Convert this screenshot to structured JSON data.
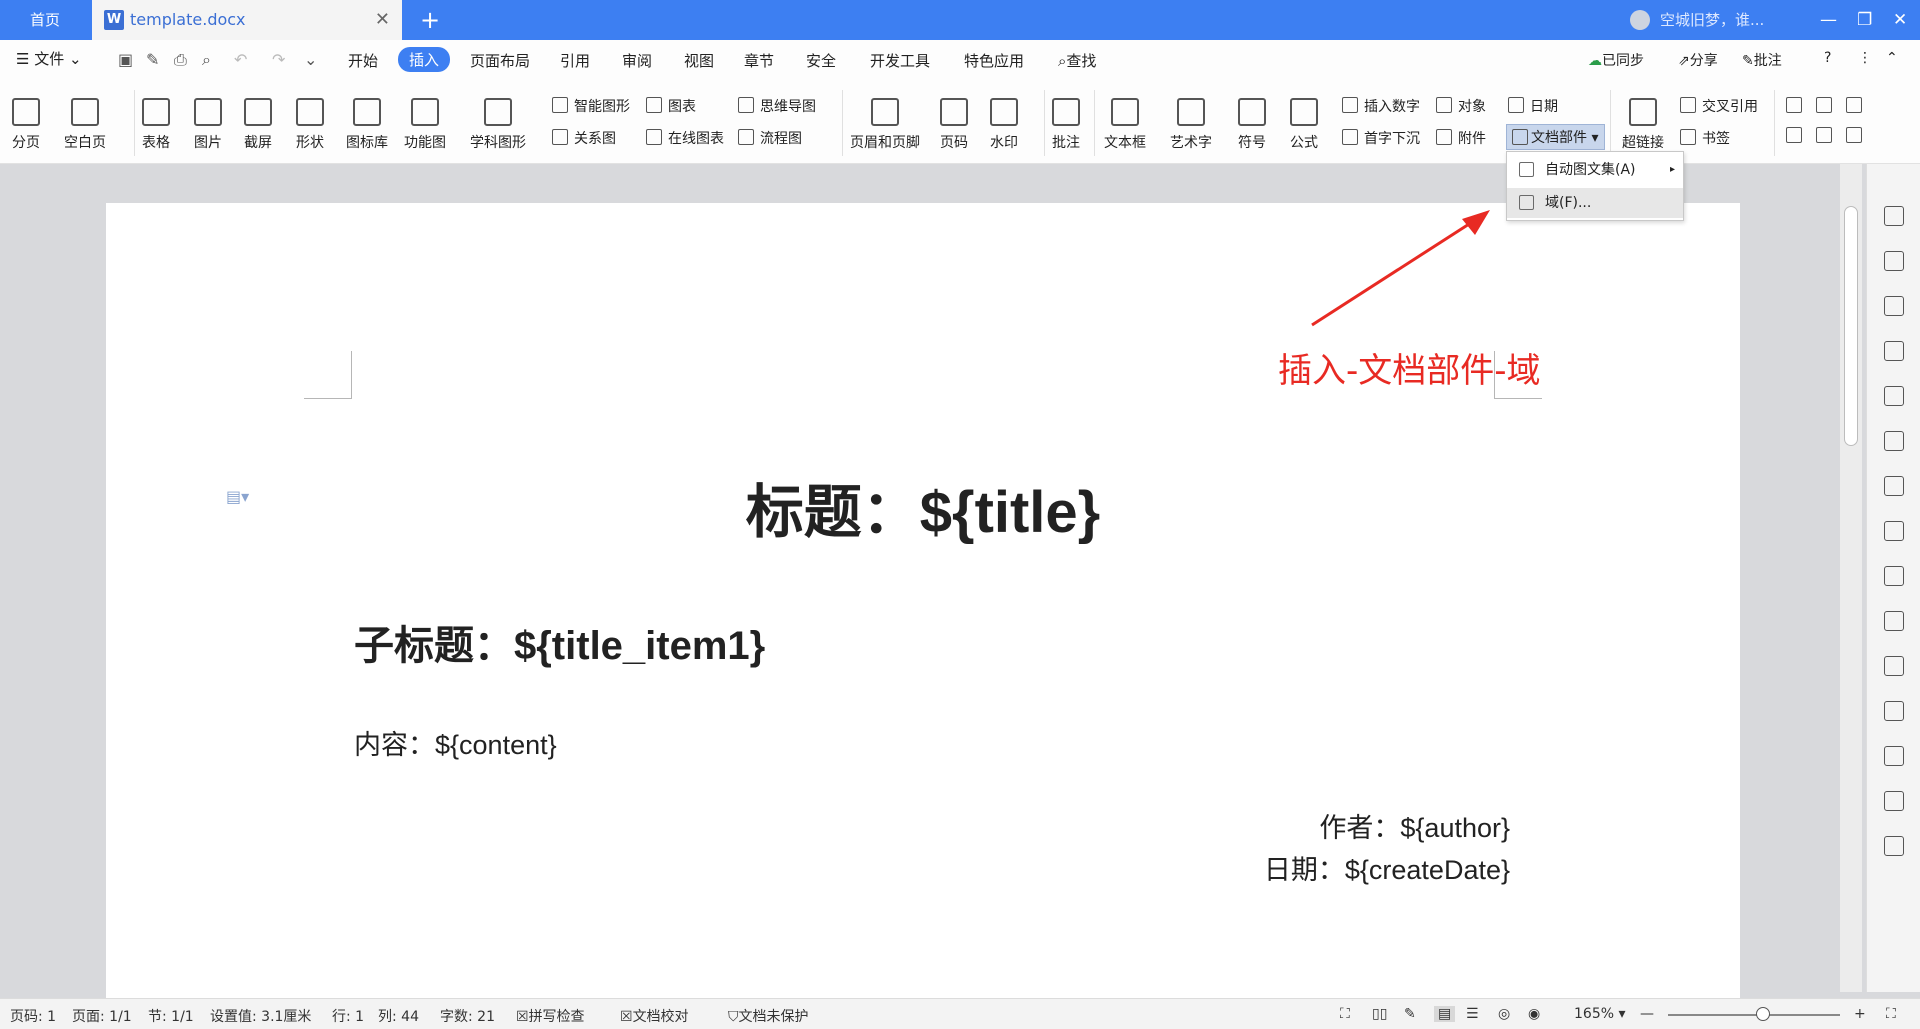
{
  "tabs": {
    "home": "首页",
    "doc": "template.docx",
    "new": "+"
  },
  "user": {
    "name": "空城旧梦，谁..."
  },
  "menu": {
    "file": "文件",
    "tabs": [
      "开始",
      "插入",
      "页面布局",
      "引用",
      "审阅",
      "视图",
      "章节",
      "安全",
      "开发工具",
      "特色应用"
    ],
    "search": "查找",
    "sync": "已同步",
    "share": "分享",
    "comment": "批注"
  },
  "ribbon": {
    "big": [
      "分页",
      "空白页",
      "表格",
      "图片",
      "截屏",
      "形状",
      "图标库",
      "功能图",
      "学科图形",
      "页眉和页脚",
      "页码",
      "水印",
      "批注",
      "文本框",
      "艺术字",
      "符号",
      "公式",
      "超链接"
    ],
    "smart": "智能图形",
    "chart": "图表",
    "mindmap": "思维导图",
    "relation": "关系图",
    "onlinechart": "在线图表",
    "flow": "流程图",
    "insertnum": "插入数字",
    "object": "对象",
    "date": "日期",
    "dropcap": "首字下沉",
    "attach": "附件",
    "docparts": "文档部件",
    "crossref": "交叉引用",
    "bookmark": "书签"
  },
  "dropdown": {
    "item1": "自动图文集(A)",
    "item2": "域(F)..."
  },
  "document": {
    "title": "标题：${title}",
    "subtitle": "子标题：${title_item1}",
    "content": "内容：${content}",
    "author": "作者：${author}",
    "date": "日期：${createDate}"
  },
  "annotation": "插入-文档部件-域",
  "status": {
    "page": "页码: 1",
    "pages": "页面: 1/1",
    "section": "节: 1/1",
    "setting": "设置值: 3.1厘米",
    "row": "行: 1",
    "col": "列: 44",
    "words": "字数: 21",
    "spell": "拼写检查",
    "proof": "文档校对",
    "protect": "文档未保护",
    "zoom": "165%"
  }
}
